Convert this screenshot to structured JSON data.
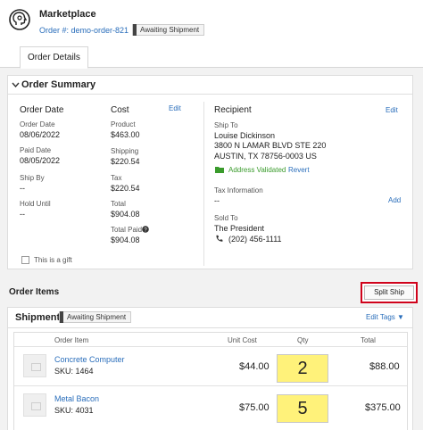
{
  "app": {
    "title": "Marketplace"
  },
  "order": {
    "number_label": "Order #: demo-order-821",
    "status": "Awaiting Shipment"
  },
  "tabs": [
    {
      "label": "Order Details",
      "active": true
    }
  ],
  "summary": {
    "title": "Order Summary",
    "order_date_col": {
      "heading": "Order Date",
      "fields": [
        {
          "label": "Order Date",
          "value": "08/06/2022"
        },
        {
          "label": "Paid Date",
          "value": "08/05/2022"
        },
        {
          "label": "Ship By",
          "value": "--"
        },
        {
          "label": "Hold Until",
          "value": "--"
        }
      ],
      "gift_label": "This is a gift"
    },
    "cost_col": {
      "heading": "Cost",
      "edit_label": "Edit",
      "fields": [
        {
          "label": "Product",
          "value": "$463.00"
        },
        {
          "label": "Shipping",
          "value": "$220.54"
        },
        {
          "label": "Tax",
          "value": "$220.54"
        },
        {
          "label": "Total",
          "value": "$904.08"
        },
        {
          "label": "Total Paid",
          "value": "$904.08"
        }
      ]
    },
    "recipient_col": {
      "heading": "Recipient",
      "edit_label": "Edit",
      "ship_to_label": "Ship To",
      "name": "Louise Dickinson",
      "address1": "3800 N LAMAR BLVD STE 220",
      "address2": "AUSTIN, TX 78756-0003 US",
      "address_validated": "Address Validated",
      "revert_label": "Revert",
      "tax_info_label": "Tax Information",
      "tax_info_value": "--",
      "add_label": "Add",
      "sold_to_label": "Sold To",
      "sold_to_name": "The President",
      "phone": "(202) 456-1111"
    }
  },
  "order_items": {
    "title": "Order Items",
    "split_ship_label": "Split Ship"
  },
  "shipment": {
    "title": "Shipment",
    "status": "Awaiting Shipment",
    "edit_tags_label": "Edit Tags ▼",
    "columns": [
      "Order Item",
      "Unit Cost",
      "Qty",
      "Total"
    ],
    "items": [
      {
        "name": "Concrete Computer",
        "sku": "SKU: 1464",
        "unit_cost": "$44.00",
        "qty": "2",
        "total": "$88.00"
      },
      {
        "name": "Metal Bacon",
        "sku": "SKU: 4031",
        "unit_cost": "$75.00",
        "qty": "5",
        "total": "$375.00"
      }
    ]
  },
  "colors": {
    "link": "#2a6ebb",
    "highlight_border": "#d0021b",
    "qty_highlight": "#fff27a",
    "validated": "#3a9b2c"
  }
}
